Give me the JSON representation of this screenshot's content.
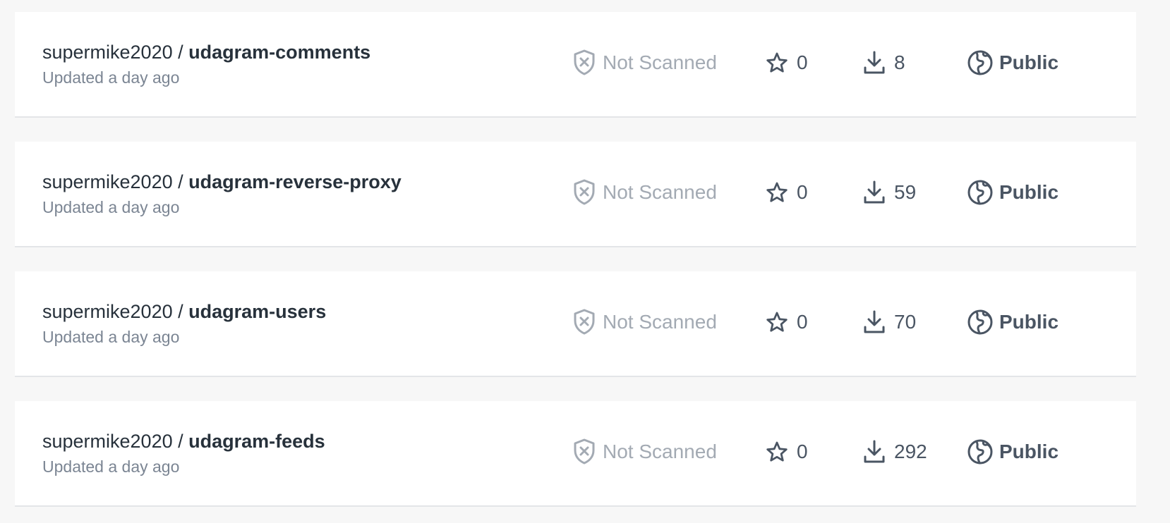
{
  "repos": [
    {
      "owner": "supermike2020",
      "separator": " / ",
      "name": "udagram-comments",
      "updated": "Updated a day ago",
      "scan_status": "Not Scanned",
      "stars": "0",
      "pulls": "8",
      "visibility": "Public"
    },
    {
      "owner": "supermike2020",
      "separator": " / ",
      "name": "udagram-reverse-proxy",
      "updated": "Updated a day ago",
      "scan_status": "Not Scanned",
      "stars": "0",
      "pulls": "59",
      "visibility": "Public"
    },
    {
      "owner": "supermike2020",
      "separator": " / ",
      "name": "udagram-users",
      "updated": "Updated a day ago",
      "scan_status": "Not Scanned",
      "stars": "0",
      "pulls": "70",
      "visibility": "Public"
    },
    {
      "owner": "supermike2020",
      "separator": " / ",
      "name": "udagram-feeds",
      "updated": "Updated a day ago",
      "scan_status": "Not Scanned",
      "stars": "0",
      "pulls": "292",
      "visibility": "Public"
    }
  ],
  "icons": {
    "scan": "shield-x-icon",
    "stars": "star-icon",
    "pulls": "download-icon",
    "visibility": "globe-icon"
  },
  "colors": {
    "background": "#f7f7f7",
    "card": "#ffffff",
    "text_primary": "#27313b",
    "text_secondary": "#7b8593",
    "muted": "#a3aab3",
    "icon": "#4a5563"
  }
}
